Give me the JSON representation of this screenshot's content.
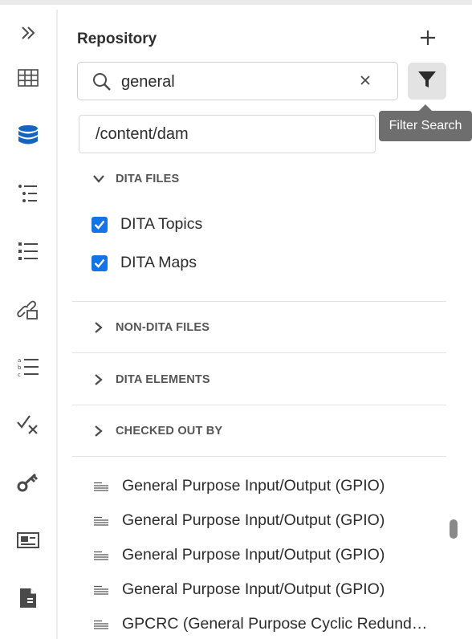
{
  "rail": {
    "items": [
      {
        "name": "expand",
        "icon": "double-chevron-right-icon"
      },
      {
        "name": "grid",
        "icon": "grid-table-icon"
      },
      {
        "name": "repository",
        "icon": "database-icon",
        "active": true
      },
      {
        "name": "outline",
        "icon": "outline-list-icon"
      },
      {
        "name": "list",
        "icon": "bullet-list-icon"
      },
      {
        "name": "links",
        "icon": "link-icon"
      },
      {
        "name": "abc-list",
        "icon": "abc-list-icon"
      },
      {
        "name": "review",
        "icon": "check-x-icon"
      },
      {
        "name": "keys",
        "icon": "key-icon"
      },
      {
        "name": "image-card",
        "icon": "image-card-icon"
      },
      {
        "name": "document",
        "icon": "document-icon"
      }
    ],
    "active_color": "#1565c0",
    "icon_color": "#4a4a4a"
  },
  "panel": {
    "title": "Repository",
    "add_icon": "plus-icon"
  },
  "search": {
    "value": "general",
    "placeholder": "",
    "icon": "search-icon",
    "clear_icon": "close-icon"
  },
  "filter_button": {
    "icon": "funnel-icon",
    "tooltip": "Filter Search"
  },
  "path": {
    "value": "/content/dam"
  },
  "sections": {
    "dita_files": {
      "label": "DITA FILES",
      "expanded": true
    },
    "non_dita_files": {
      "label": "NON-DITA FILES",
      "expanded": false
    },
    "dita_elements": {
      "label": "DITA ELEMENTS",
      "expanded": false
    },
    "checked_out_by": {
      "label": "CHECKED OUT BY",
      "expanded": false
    }
  },
  "dita_options": [
    {
      "label": "DITA Topics",
      "checked": true
    },
    {
      "label": "DITA Maps",
      "checked": true
    }
  ],
  "checkbox_color": "#1473e6",
  "results": [
    "General Purpose Input/Output (GPIO)",
    "General Purpose Input/Output (GPIO)",
    "General Purpose Input/Output (GPIO)",
    "General Purpose Input/Output (GPIO)",
    "GPCRC (General Purpose Cyclic Redundanc..."
  ]
}
